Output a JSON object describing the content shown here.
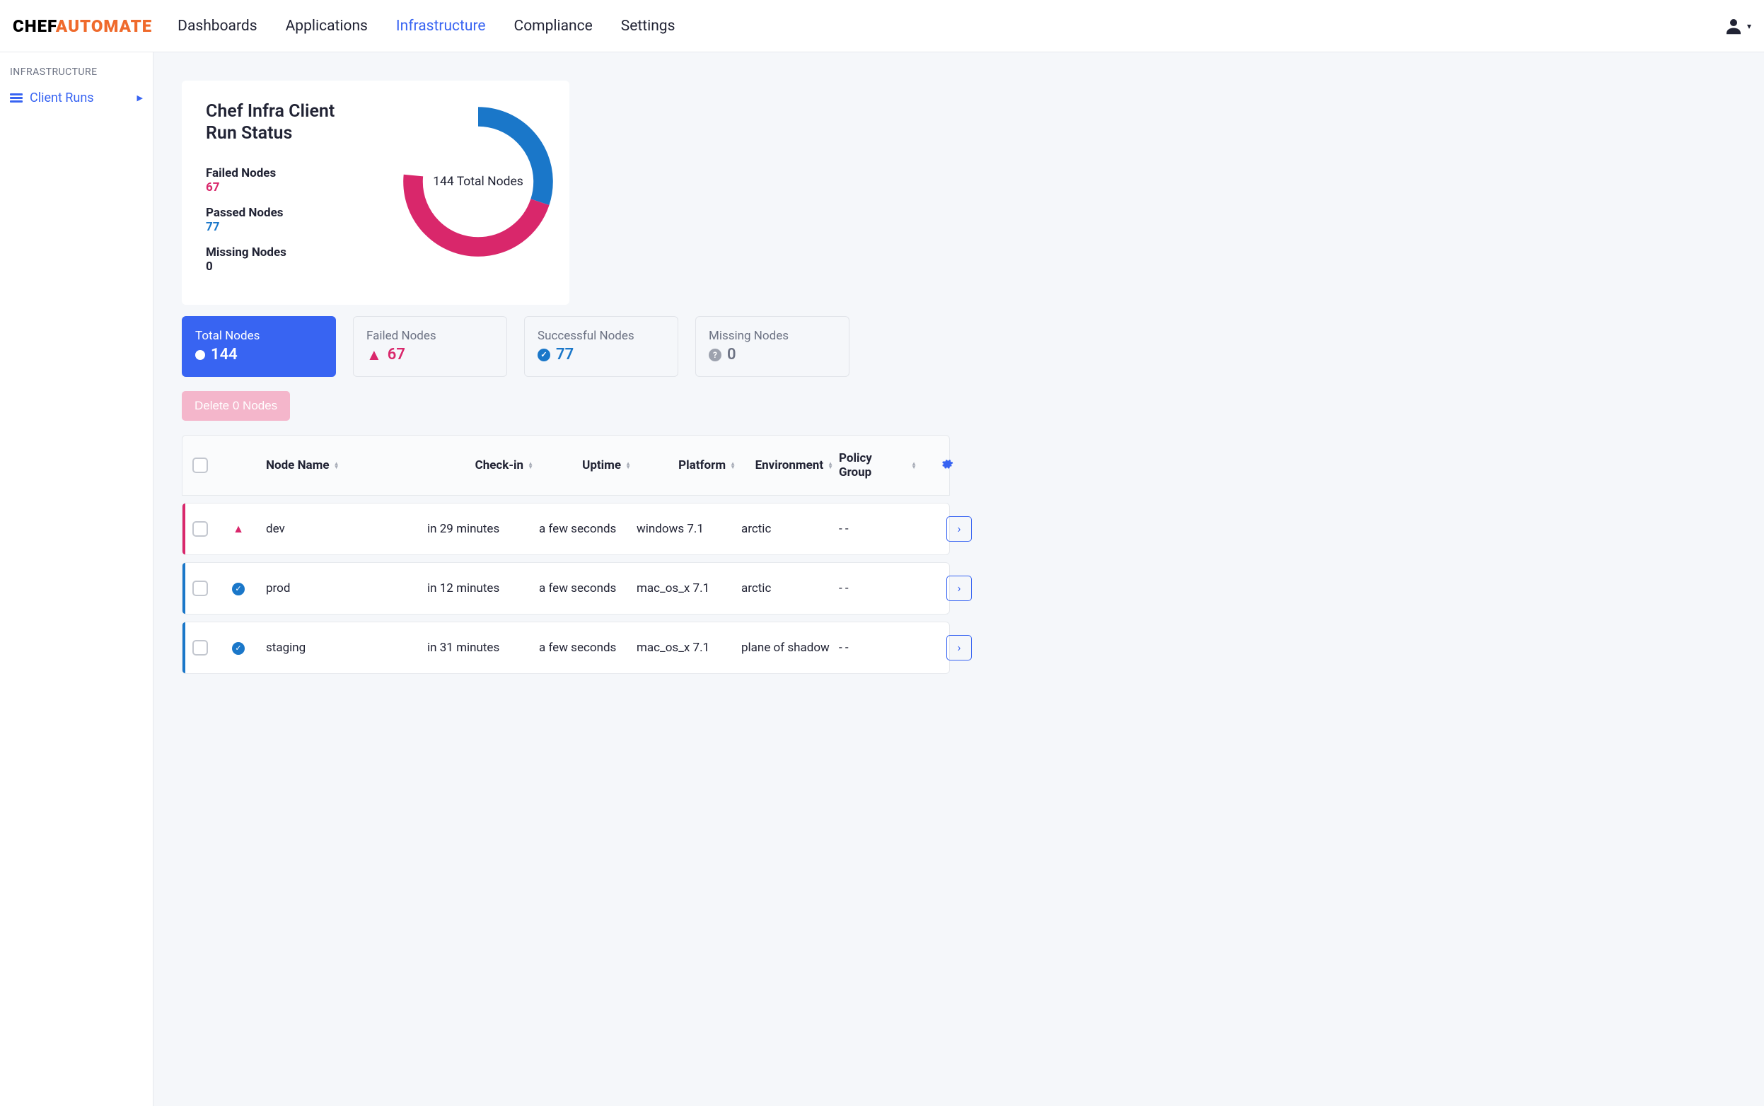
{
  "logo": {
    "part1": "CHEF",
    "part2": "AUTOMATE"
  },
  "nav": [
    "Dashboards",
    "Applications",
    "Infrastructure",
    "Compliance",
    "Settings"
  ],
  "nav_active_index": 2,
  "sidebar": {
    "heading": "INFRASTRUCTURE",
    "items": [
      {
        "label": "Client Runs"
      }
    ]
  },
  "status_card": {
    "title": "Chef Infra Client Run Status",
    "failed_label": "Failed Nodes",
    "failed_value": "67",
    "passed_label": "Passed Nodes",
    "passed_value": "77",
    "missing_label": "Missing Nodes",
    "missing_value": "0",
    "center_text": "144 Total Nodes"
  },
  "chart_data": {
    "type": "pie",
    "title": "Chef Infra Client Run Status",
    "series": [
      {
        "name": "Failed Nodes",
        "value": 67,
        "color": "#d9276b"
      },
      {
        "name": "Passed Nodes",
        "value": 77,
        "color": "#1a77c9"
      },
      {
        "name": "Missing Nodes",
        "value": 0,
        "color": "#9da2ae"
      }
    ],
    "total": 144,
    "center_label": "144 Total Nodes"
  },
  "filters": [
    {
      "label": "Total Nodes",
      "value": "144",
      "kind": "total"
    },
    {
      "label": "Failed Nodes",
      "value": "67",
      "kind": "failed"
    },
    {
      "label": "Successful Nodes",
      "value": "77",
      "kind": "success"
    },
    {
      "label": "Missing Nodes",
      "value": "0",
      "kind": "missing"
    }
  ],
  "delete_button": "Delete 0 Nodes",
  "columns": [
    "Node Name",
    "Check-in",
    "Uptime",
    "Platform",
    "Environment",
    "Policy Group"
  ],
  "rows": [
    {
      "status": "failed",
      "name": "dev",
      "checkin": "in 29 minutes",
      "uptime": "a few seconds",
      "platform": "windows 7.1",
      "environment": "arctic",
      "policy_group": "- -"
    },
    {
      "status": "passed",
      "name": "prod",
      "checkin": "in 12 minutes",
      "uptime": "a few seconds",
      "platform": "mac_os_x 7.1",
      "environment": "arctic",
      "policy_group": "- -"
    },
    {
      "status": "passed",
      "name": "staging",
      "checkin": "in 31 minutes",
      "uptime": "a few seconds",
      "platform": "mac_os_x 7.1",
      "environment": "plane of shadow",
      "policy_group": "- -"
    }
  ]
}
